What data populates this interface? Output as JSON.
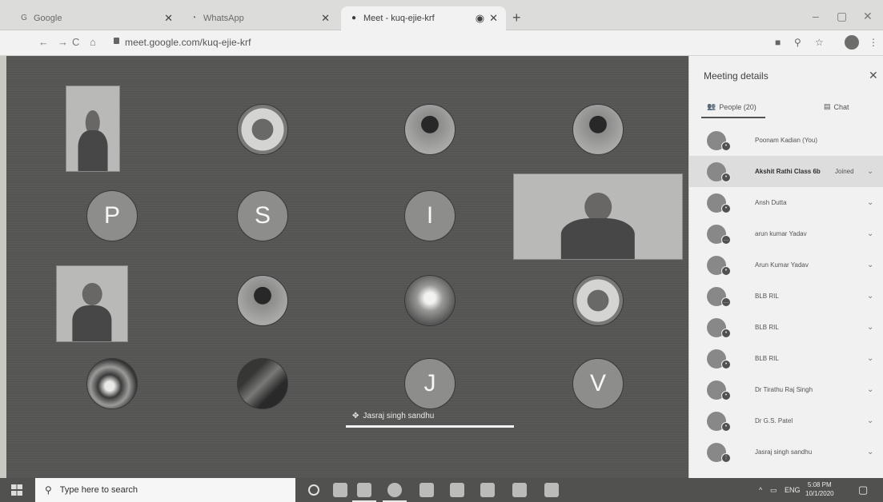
{
  "browser": {
    "tabs": [
      {
        "title": "Google",
        "icon": "google-icon",
        "active": false
      },
      {
        "title": "WhatsApp",
        "icon": "whatsapp-icon",
        "active": false
      },
      {
        "title": "Meet - kuq-ejie-krf",
        "icon": "meet-icon",
        "active": true
      }
    ],
    "url": "meet.google.com/kuq-ejie-krf"
  },
  "meet": {
    "tiles": [
      {
        "letter": "P"
      },
      {
        "letter": "S"
      },
      {
        "letter": "I"
      },
      {
        "letter": "J"
      },
      {
        "letter": "V"
      }
    ],
    "speaker_name": "Jasraj singh sandhu"
  },
  "panel": {
    "title": "Meeting details",
    "tab_people": "People (20)",
    "tab_chat": "Chat",
    "participants": [
      {
        "name": "Poonam Kadian (You)",
        "extra": ""
      },
      {
        "name": "Akshit Rathi Class 6b",
        "extra": "Joined"
      },
      {
        "name": "Ansh Dutta",
        "extra": ""
      },
      {
        "name": "arun kumar Yadav",
        "extra": ""
      },
      {
        "name": "Arun Kumar Yadav",
        "extra": ""
      },
      {
        "name": "BLB RIL",
        "extra": ""
      },
      {
        "name": "BLB RIL",
        "extra": ""
      },
      {
        "name": "BLB RIL",
        "extra": ""
      },
      {
        "name": "Dr Tirathu Raj Singh",
        "extra": ""
      },
      {
        "name": "Dr G.S. Patel",
        "extra": ""
      },
      {
        "name": "Jasraj singh sandhu",
        "extra": ""
      }
    ]
  },
  "taskbar": {
    "search_placeholder": "Type here to search",
    "language": "ENG",
    "time": "5:08 PM",
    "date": "10/1/2020"
  }
}
